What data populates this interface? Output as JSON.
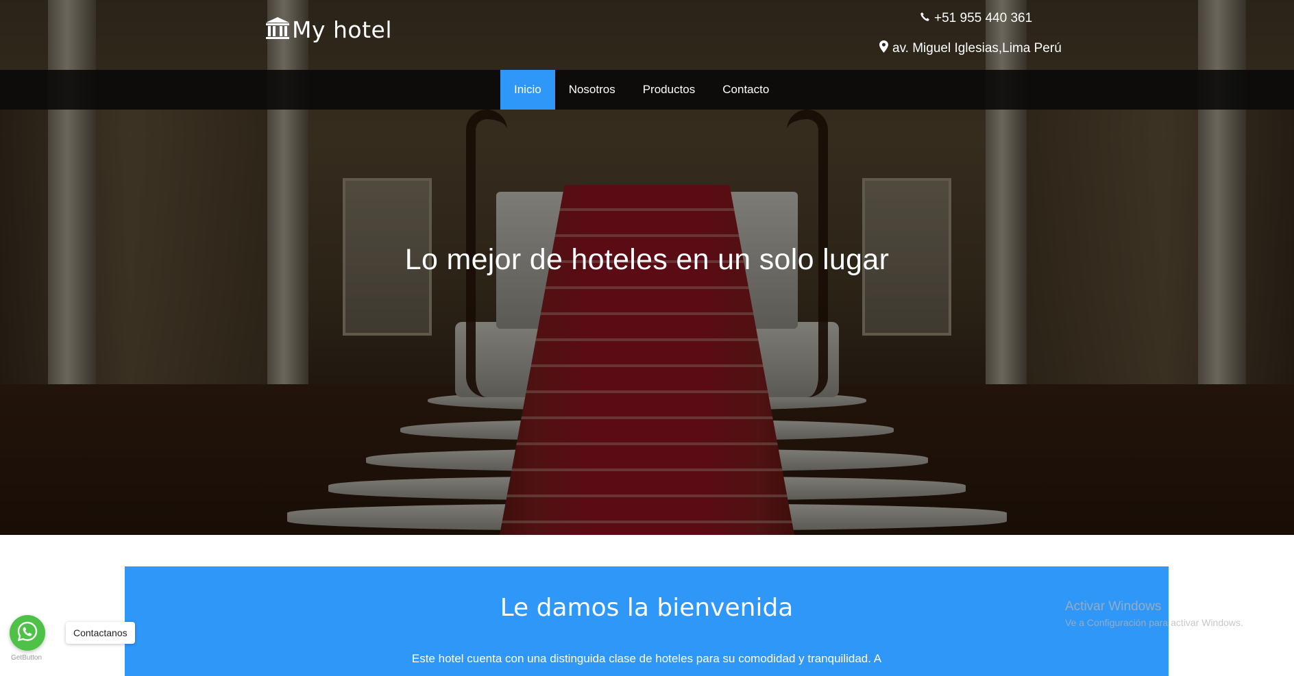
{
  "header": {
    "logo_icon": "bank-building-icon",
    "logo_text": "My hotel",
    "phone_icon": "phone-icon",
    "phone": "+51 955 440 361",
    "address_icon": "map-marker-icon",
    "address": "av. Miguel Iglesias,Lima Perú"
  },
  "nav": {
    "items": [
      {
        "label": "Inicio",
        "active": true
      },
      {
        "label": "Nosotros",
        "active": false
      },
      {
        "label": "Productos",
        "active": false
      },
      {
        "label": "Contacto",
        "active": false
      }
    ]
  },
  "hero": {
    "title": "Lo mejor de hoteles en un solo lugar"
  },
  "welcome": {
    "title": "Le damos la bienvenida",
    "text": "Este hotel cuenta con una distinguida clase de hoteles para su comodidad y tranquilidad. A"
  },
  "watermark": {
    "title": "Activar Windows",
    "subtitle": "Ve a Configuración para activar Windows."
  },
  "whatsapp": {
    "icon": "whatsapp-icon",
    "label": "Contactanos",
    "credit": "GetButton"
  },
  "colors": {
    "accent": "#2f97f7",
    "navbar": "#080808",
    "whatsapp": "#4dc247"
  }
}
